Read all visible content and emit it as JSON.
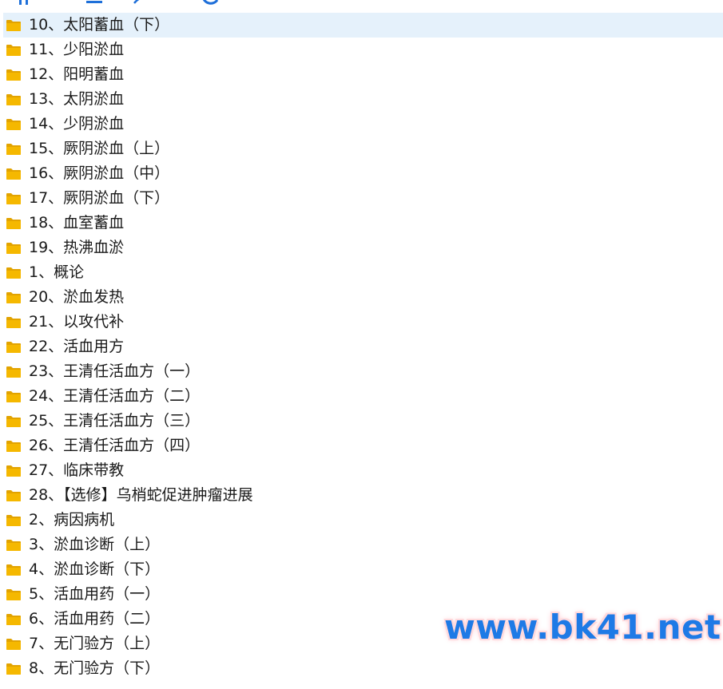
{
  "colors": {
    "folder": "#f5b800",
    "folder_dark": "#e2a300",
    "selected_row": "#e5f1fb",
    "watermark": "#1e7ae6"
  },
  "folders": [
    {
      "name": "10、太阳蓄血（下）",
      "icon": "folder-icon",
      "selected": true
    },
    {
      "name": "11、少阳淤血",
      "icon": "folder-icon"
    },
    {
      "name": "12、阳明蓄血",
      "icon": "folder-icon"
    },
    {
      "name": "13、太阴淤血",
      "icon": "folder-icon"
    },
    {
      "name": "14、少阴淤血",
      "icon": "folder-icon"
    },
    {
      "name": "15、厥阴淤血（上）",
      "icon": "folder-icon"
    },
    {
      "name": "16、厥阴淤血（中）",
      "icon": "folder-icon"
    },
    {
      "name": "17、厥阴淤血（下）",
      "icon": "folder-icon"
    },
    {
      "name": "18、血室蓄血",
      "icon": "folder-icon"
    },
    {
      "name": "19、热沸血淤",
      "icon": "folder-icon"
    },
    {
      "name": "1、概论",
      "icon": "folder-icon"
    },
    {
      "name": "20、淤血发热",
      "icon": "folder-icon"
    },
    {
      "name": "21、以攻代补",
      "icon": "folder-icon"
    },
    {
      "name": "22、活血用方",
      "icon": "folder-icon"
    },
    {
      "name": "23、王清任活血方（一）",
      "icon": "folder-icon"
    },
    {
      "name": "24、王清任活血方（二）",
      "icon": "folder-icon"
    },
    {
      "name": "25、王清任活血方（三）",
      "icon": "folder-icon"
    },
    {
      "name": "26、王清任活血方（四）",
      "icon": "folder-icon"
    },
    {
      "name": "27、临床带教",
      "icon": "folder-icon"
    },
    {
      "name": "28、【选修】乌梢蛇促进肿瘤进展",
      "icon": "folder-icon"
    },
    {
      "name": "2、病因病机",
      "icon": "folder-icon"
    },
    {
      "name": "3、淤血诊断（上）",
      "icon": "folder-icon"
    },
    {
      "name": "4、淤血诊断（下）",
      "icon": "folder-icon"
    },
    {
      "name": "5、活血用药（一）",
      "icon": "folder-icon"
    },
    {
      "name": "6、活血用药（二）",
      "icon": "folder-icon"
    },
    {
      "name": "7、无门验方（上）",
      "icon": "folder-icon"
    },
    {
      "name": "8、无门验方（下）",
      "icon": "folder-icon"
    }
  ],
  "watermark": {
    "text": "www.bk41.net"
  }
}
